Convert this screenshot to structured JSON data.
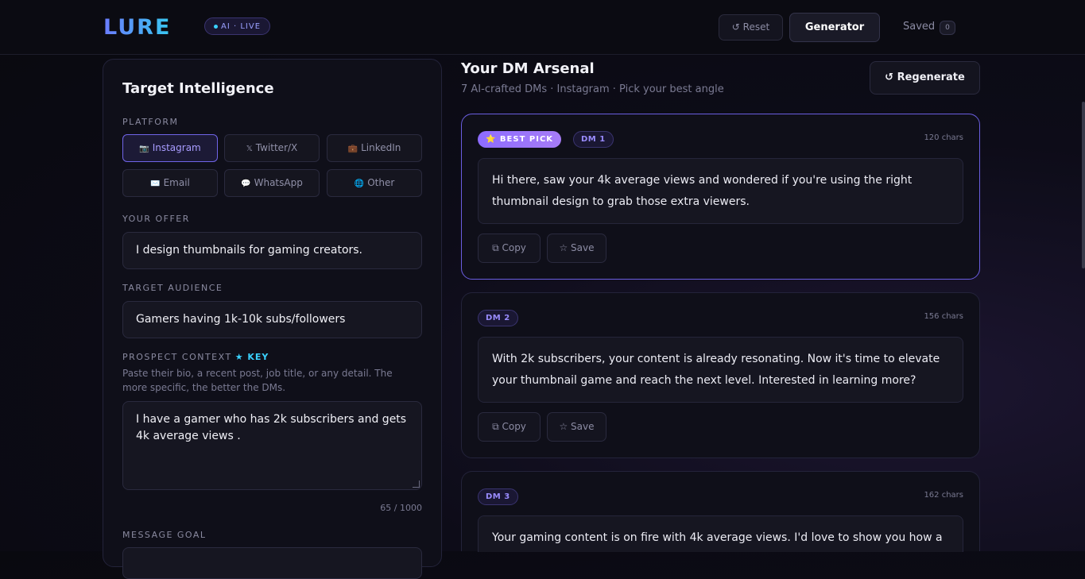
{
  "header": {
    "logo": "LURE",
    "live_badge": "AI · LIVE",
    "reset_label": "↺ Reset",
    "generator_label": "Generator",
    "saved_label": "Saved",
    "saved_count": "0"
  },
  "form": {
    "title": "Target Intelligence",
    "platform_label": "PLATFORM",
    "platforms": [
      {
        "icon": "📷",
        "label": "Instagram",
        "active": true
      },
      {
        "icon": "𝕏",
        "label": "Twitter/X",
        "active": false
      },
      {
        "icon": "💼",
        "label": "LinkedIn",
        "active": false
      },
      {
        "icon": "✉️",
        "label": "Email",
        "active": false
      },
      {
        "icon": "💬",
        "label": "WhatsApp",
        "active": false
      },
      {
        "icon": "🌐",
        "label": "Other",
        "active": false
      }
    ],
    "offer_label": "YOUR OFFER",
    "offer_value": "I design thumbnails for gaming creators.",
    "audience_label": "TARGET AUDIENCE",
    "audience_value": "Gamers having 1k-10k subs/followers",
    "context_label": "PROSPECT CONTEXT",
    "context_key": "★ KEY",
    "context_help": "Paste their bio, a recent post, job title, or any detail. The more specific, the better the DMs.",
    "context_value": "I have a gamer who has 2k subscribers and gets 4k average views .",
    "char_count": "65 / 1000",
    "goal_label": "MESSAGE GOAL"
  },
  "results": {
    "title": "Your DM Arsenal",
    "subtitle": "7 AI-crafted DMs · Instagram · Pick your best angle",
    "regenerate_label": "↺ Regenerate",
    "best_pick_label": "⭐ BEST PICK",
    "copy_label": "Copy",
    "save_label": "Save",
    "dms": [
      {
        "tag": "DM 1",
        "chars": "120 chars",
        "text": "Hi there, saw your 4k average views and wondered if you're using the right thumbnail design to grab those extra viewers."
      },
      {
        "tag": "DM 2",
        "chars": "156 chars",
        "text": "With 2k subscribers, your content is already resonating. Now it's time to elevate your thumbnail game and reach the next level. Interested in learning more?"
      },
      {
        "tag": "DM 3",
        "chars": "162 chars",
        "text": "Your gaming content is on fire with 4k average views. I'd love to show you how a"
      }
    ]
  },
  "colors": {
    "accent": "#7064e8",
    "logo_gradient_start": "#6b7cff",
    "logo_gradient_end": "#38c8f0",
    "key_cyan": "#3ad1ff",
    "background": "#09090f"
  }
}
